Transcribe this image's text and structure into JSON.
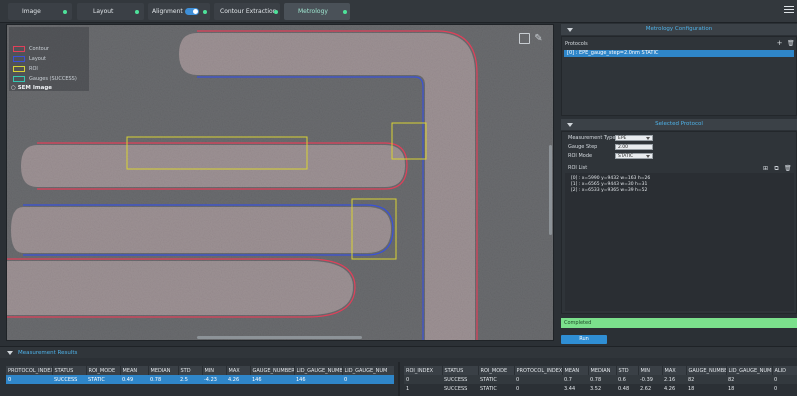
{
  "tabs": [
    {
      "label": "Image",
      "active": false
    },
    {
      "label": "Layout",
      "active": false
    },
    {
      "label": "Alignment",
      "active": false,
      "toggle": true
    },
    {
      "label": "Contour Extraction",
      "active": false
    },
    {
      "label": "Metrology",
      "active": true
    }
  ],
  "legend": {
    "items": [
      {
        "label": "Contour",
        "color": "#e0405a"
      },
      {
        "label": "Layout",
        "color": "#3a52d8"
      },
      {
        "label": "ROI",
        "color": "#d8d233"
      },
      {
        "label": "Gauges (SUCCESS)",
        "color": "#34c7b4"
      }
    ],
    "sem_image": "SEM Image"
  },
  "metrology_config": {
    "title": "Metrology Configuration",
    "protocols_label": "Protocols",
    "protocol_item": "[0] : EPE_gauge_step=2.0nm  STATIC"
  },
  "selected_protocol": {
    "title": "Selected Protocol",
    "measurement_type_label": "Measurement Type",
    "measurement_type_value": "EPE",
    "gauge_step_label": "Gauge Step",
    "gauge_step_value": "2.00",
    "roi_mode_label": "ROI Mode",
    "roi_mode_value": "STATIC",
    "roi_list_label": "ROI List",
    "roi_items": [
      "[0] : x=5990 y=9432 w=163 h=26",
      "[1] : x=6565 y=9443 w=30 h=31",
      "[2] : x=6533 y=9365 w=39 h=52"
    ]
  },
  "status": "Completed",
  "run_button": "Run",
  "results": {
    "title": "Measurement Results",
    "left_columns": [
      "PROTOCOL_INDEX",
      "STATUS",
      "ROI_MODE",
      "MEAN",
      "MEDIAN",
      "STD",
      "MIN",
      "MAX",
      "GAUGE_NUMBER",
      "LID_GAUGE_NUMB",
      "LID_GAUGE_NUM"
    ],
    "left_rows": [
      [
        "0",
        "SUCCESS",
        "STATIC",
        "0.49",
        "0.78",
        "2.5",
        "-4.23",
        "4.26",
        "146",
        "146",
        "0"
      ]
    ],
    "right_columns": [
      "ROI_INDEX",
      "STATUS",
      "ROI_MODE",
      "PROTOCOL_INDEX",
      "MEAN",
      "MEDIAN",
      "STD",
      "MIN",
      "MAX",
      "GAUGE_NUMBER",
      "LID_GAUGE_NUMB",
      "ALID"
    ],
    "right_rows": [
      [
        "0",
        "SUCCESS",
        "STATIC",
        "0",
        "0.7",
        "0.78",
        "0.6",
        "-0.39",
        "2.16",
        "82",
        "82",
        "0"
      ],
      [
        "1",
        "SUCCESS",
        "STATIC",
        "0",
        "3.44",
        "3.52",
        "0.48",
        "2.62",
        "4.26",
        "18",
        "18",
        "0"
      ]
    ]
  }
}
